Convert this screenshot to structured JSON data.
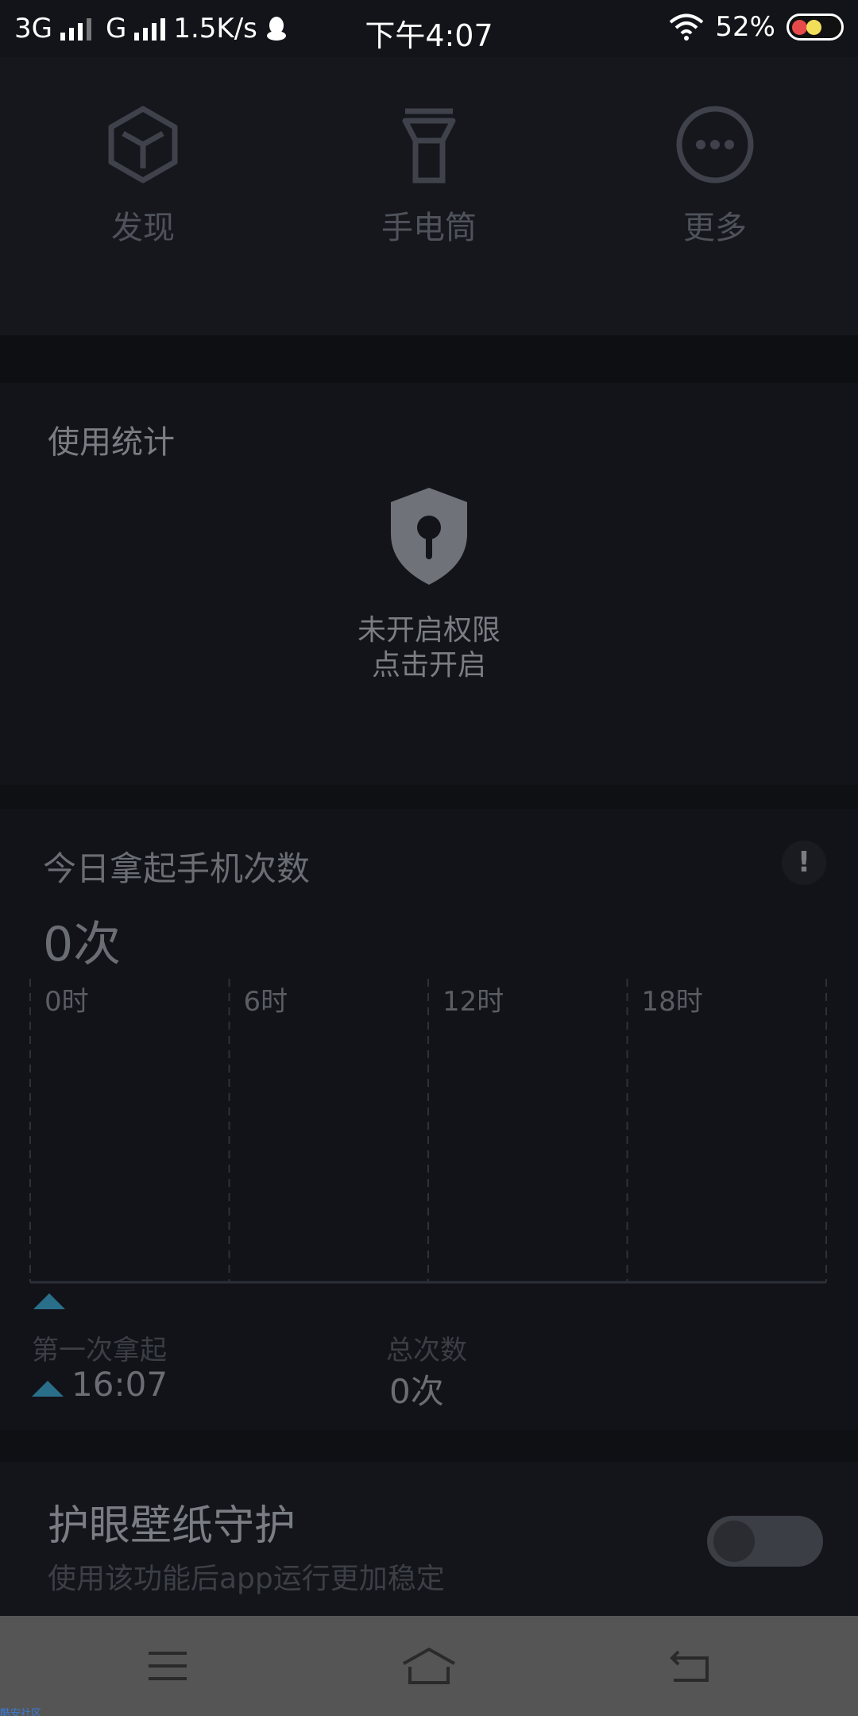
{
  "status_bar": {
    "network1": "3G",
    "network2": "G",
    "speed": "1.5K/s",
    "time": "下午4:07",
    "battery": "52%"
  },
  "shortcuts": [
    {
      "label": "发现",
      "icon": "cube-icon"
    },
    {
      "label": "手电筒",
      "icon": "flashlight-icon"
    },
    {
      "label": "更多",
      "icon": "more-icon"
    }
  ],
  "usage_stats": {
    "title": "使用统计",
    "permission_line1": "未开启权限",
    "permission_line2": "点击开启",
    "icon": "shield-keyhole-icon"
  },
  "pickups": {
    "title": "今日拿起手机次数",
    "count": "0次",
    "info_icon": "!",
    "first_pickup_label": "第一次拿起",
    "first_pickup_time": "16:07",
    "total_label": "总次数",
    "total_value": "0次"
  },
  "chart_data": {
    "type": "bar",
    "categories": [
      "0时",
      "6时",
      "12时",
      "18时"
    ],
    "values": [
      0,
      0,
      0,
      0
    ],
    "title": "",
    "xlabel": "",
    "ylabel": "",
    "grid": true,
    "marker_time": "16:07",
    "marker_color": "#2a6f8a"
  },
  "eye_protection": {
    "title": "护眼壁纸守护",
    "subtitle": "使用该功能后app运行更加稳定",
    "enabled": false
  },
  "nav": {
    "menu": "menu-icon",
    "home": "home-icon",
    "back": "back-icon"
  },
  "watermark": "酷安社区"
}
